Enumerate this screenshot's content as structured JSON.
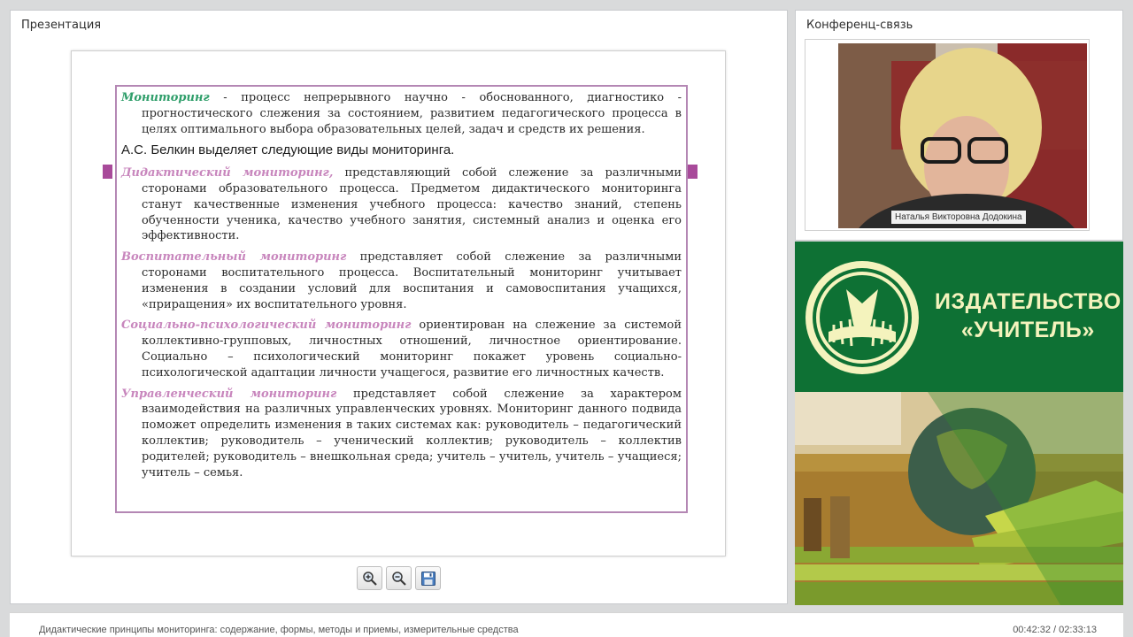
{
  "presentation_panel": {
    "title": "Презентация"
  },
  "slide": {
    "p1_term": "Мониторинг",
    "p1_text": " - процесс непрерывного научно - обоснованного, диагностико - прогностического слежения за состоянием, развитием педагогического процесса в целях оптимального выбора образовательных целей, задач и средств их решения.",
    "heading": "А.С. Белкин выделяет следующие виды мониторинга.",
    "p2_term": "Дидактический мониторинг,",
    "p2_text": " представляющий собой слежение за различными сторонами образовательного процесса. Предметом дидактического мониторинга станут качественные изменения учебного процесса: качество знаний, степень обученности ученика, качество учебного занятия, системный анализ и оценка его эффективности.",
    "p3_term": "Воспитательный мониторинг",
    "p3_text": " представляет собой слежение за различными сторонами воспитательного процесса. Воспитательный мониторинг учитывает изменения в создании условий для воспитания и самовоспитания учащихся, «приращения» их воспитательного уровня.",
    "p4_term": "Социально-психологический мониторинг",
    "p4_text": " ориентирован на слежение за системой коллективно-групповых, личностных отношений, личностное ориентирование. Социально – психологический мониторинг покажет уровень социально-психологической адаптации личности учащегося, развитие его личностных качеств.",
    "p5_term": "Управленческий мониторинг",
    "p5_text": " представляет собой слежение за характером взаимодействия на различных управленческих уровнях. Мониторинг данного подвида поможет определить изменения в таких системах как: руководитель – педагогический коллектив; руководитель – ученический коллектив; руководитель – коллектив родителей; руководитель – внешкольная среда; учитель – учитель, учитель – учащиеся; учитель – семья."
  },
  "toolbar": {
    "zoom_in_icon": "zoom-in-icon",
    "zoom_out_icon": "zoom-out-icon",
    "save_icon": "save-icon"
  },
  "conference_panel": {
    "title": "Конференц-связь",
    "participant_name": "Наталья Викторовна Додокина"
  },
  "brand": {
    "line1": "ИЗДАТЕЛЬСТВО",
    "line2": "«УЧИТЕЛЬ»"
  },
  "status_bar": {
    "lecture_title": "Дидактические принципы мониторинга: содержание, формы, методы и приемы, измерительные средства",
    "time": "00:42:32 / 02:33:13"
  },
  "colors": {
    "brand_green": "#0e7134",
    "brand_text": "#f4f3bd",
    "term_green": "#2f9e6a",
    "term_pink": "#c886bd",
    "frame_border": "#b487b4"
  }
}
